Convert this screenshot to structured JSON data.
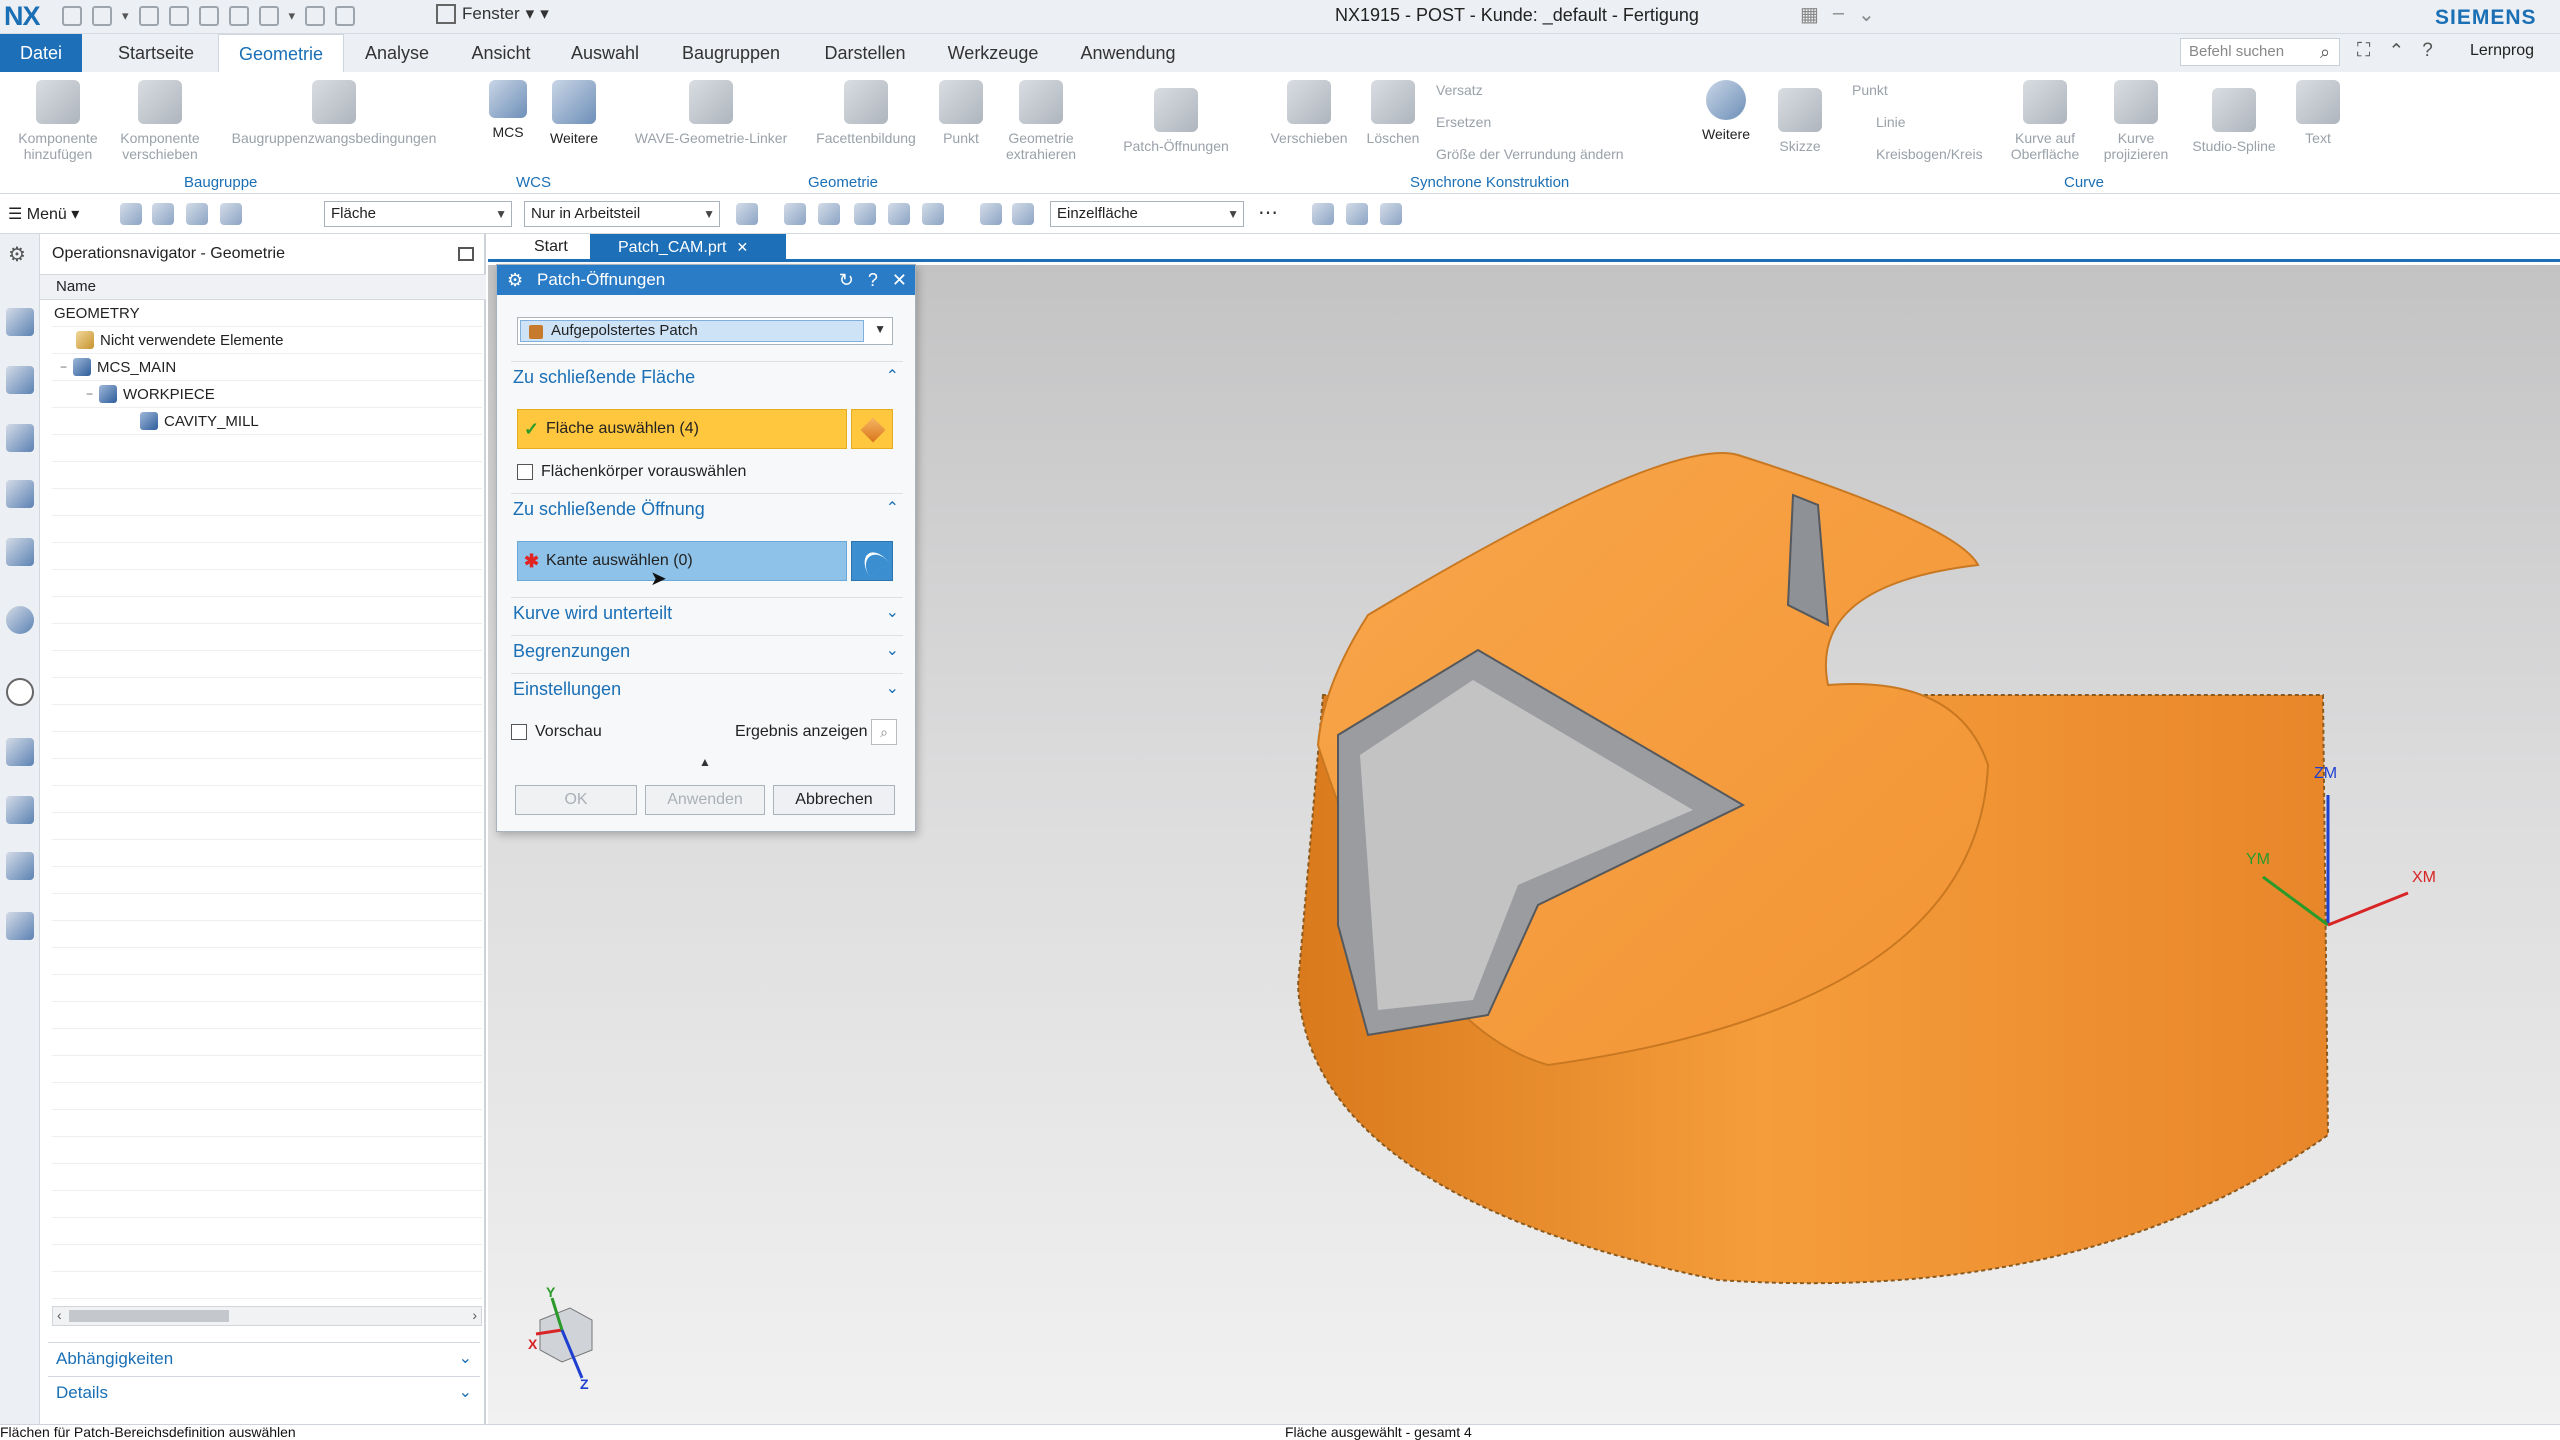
{
  "app": {
    "logo": "NX",
    "window_title": "NX1915 - POST - Kunde: _default - Fertigung",
    "brand": "SIEMENS",
    "fenster_label": "Fenster",
    "search_placeholder": "Befehl suchen",
    "learn_label": "Lernprog"
  },
  "menu_tabs": [
    "Datei",
    "Startseite",
    "Geometrie",
    "Analyse",
    "Ansicht",
    "Auswahl",
    "Baugruppen",
    "Darstellen",
    "Werkzeuge",
    "Anwendung"
  ],
  "active_tab": "Geometrie",
  "ribbon": {
    "groups": [
      "Baugruppe",
      "WCS",
      "Geometrie",
      "Synchrone Konstruktion",
      "Curve"
    ],
    "buttons": [
      "Komponente hinzufügen",
      "Komponente verschieben",
      "Baugruppenzwangsbedingungen",
      "Weitere",
      "WAVE-Geometrie-Linker",
      "Facettenbildung",
      "Punkt",
      "Geometrie extrahieren",
      "Patch-Öffnungen",
      "Verschieben",
      "Löschen",
      "Weitere",
      "Skizze",
      "Kurve auf Oberfläche",
      "Kurve projizieren",
      "Studio-Spline",
      "Text"
    ],
    "small_buttons": [
      "Versatz",
      "Ersetzen",
      "Größe der Verrundung ändern",
      "Punkt",
      "Linie",
      "Kreisbogen/Kreis"
    ],
    "wcs_badge": "MCS"
  },
  "toolbar2": {
    "menu": "Menü",
    "filter_type": "Fläche",
    "scope": "Nur in Arbeitsteil",
    "face_rule": "Einzelfläche",
    "more": "⋯"
  },
  "navigator": {
    "title": "Operationsnavigator - Geometrie",
    "col_name": "Name",
    "tree": [
      "GEOMETRY",
      "Nicht verwendete Elemente",
      "MCS_MAIN",
      "WORKPIECE",
      "CAVITY_MILL"
    ],
    "bottom_sections": [
      "Abhängigkeiten",
      "Details"
    ]
  },
  "doc_tabs": [
    {
      "label": "Start"
    },
    {
      "label": "Patch_CAM.prt"
    }
  ],
  "dialog": {
    "title": "Patch-Öffnungen",
    "patch_type": "Aufgepolstertes Patch",
    "sec_face": "Zu schließende Fläche",
    "face_select": "Fläche auswählen (4)",
    "preselect": "Flächenkörper vorauswählen",
    "sec_opening": "Zu schließende Öffnung",
    "edge_select": "Kante auswählen (0)",
    "sec_curve": "Kurve wird unterteilt",
    "sec_limits": "Begrenzungen",
    "sec_settings": "Einstellungen",
    "preview": "Vorschau",
    "show_result": "Ergebnis anzeigen",
    "ok": "OK",
    "apply": "Anwenden",
    "cancel": "Abbrechen"
  },
  "viewport": {
    "axis_zm": "ZM",
    "axis_ym": "YM",
    "axis_xm": "XM",
    "axis_z": "Z",
    "axis_x": "X",
    "axis_y": "Y",
    "model_color": "#f39b3a"
  },
  "status": {
    "left": "Flächen für Patch-Bereichsdefinition auswählen",
    "center": "Fläche ausgewählt - gesamt 4"
  }
}
